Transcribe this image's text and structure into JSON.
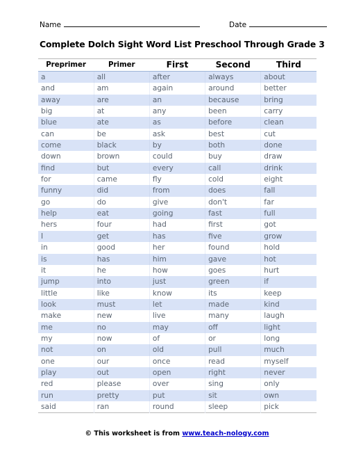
{
  "worksheet": {
    "name_label": "Name",
    "date_label": "Date",
    "title": "Complete Dolch Sight Word List Preschool Through Grade 3"
  },
  "footer": {
    "copyright_text": "© This worksheet is from",
    "link_text": "www.teach-nology.com",
    "link_color": "#0000cc"
  },
  "table": {
    "columns": [
      {
        "label": "Preprimer",
        "size": "small"
      },
      {
        "label": "Primer",
        "size": "small"
      },
      {
        "label": "First",
        "size": "big"
      },
      {
        "label": "Second",
        "size": "big"
      },
      {
        "label": "Third",
        "size": "big"
      }
    ],
    "row_band_color": "#d9e3f7",
    "text_color": "#5b6572",
    "rows": [
      [
        "a",
        "all",
        "after",
        "always",
        "about"
      ],
      [
        "and",
        "am",
        "again",
        "around",
        "better"
      ],
      [
        "away",
        "are",
        "an",
        "because",
        "bring"
      ],
      [
        "big",
        "at",
        "any",
        "been",
        "carry"
      ],
      [
        "blue",
        "ate",
        "as",
        "before",
        "clean"
      ],
      [
        "can",
        "be",
        "ask",
        "best",
        "cut"
      ],
      [
        "come",
        "black",
        "by",
        "both",
        "done"
      ],
      [
        "down",
        "brown",
        "could",
        "buy",
        "draw"
      ],
      [
        "find",
        "but",
        "every",
        "call",
        "drink"
      ],
      [
        "for",
        "came",
        "fly",
        "cold",
        "eight"
      ],
      [
        "funny",
        "did",
        "from",
        "does",
        "fall"
      ],
      [
        "go",
        "do",
        "give",
        "don't",
        "far"
      ],
      [
        "help",
        "eat",
        "going",
        "fast",
        "full"
      ],
      [
        "hers",
        "four",
        "had",
        "first",
        "got"
      ],
      [
        "I",
        "get",
        "has",
        "five",
        "grow"
      ],
      [
        "in",
        "good",
        "her",
        "found",
        "hold"
      ],
      [
        "is",
        "has",
        "him",
        "gave",
        "hot"
      ],
      [
        "it",
        "he",
        "how",
        "goes",
        "hurt"
      ],
      [
        "jump",
        "into",
        "just",
        "green",
        "if"
      ],
      [
        "little",
        "like",
        "know",
        "its",
        "keep"
      ],
      [
        "look",
        "must",
        "let",
        "made",
        "kind"
      ],
      [
        "make",
        "new",
        "live",
        "many",
        "laugh"
      ],
      [
        "me",
        "no",
        "may",
        "off",
        "light"
      ],
      [
        "my",
        "now",
        "of",
        "or",
        "long"
      ],
      [
        "not",
        "on",
        "old",
        "pull",
        "much"
      ],
      [
        "one",
        "our",
        "once",
        "read",
        "myself"
      ],
      [
        "play",
        "out",
        "open",
        "right",
        "never"
      ],
      [
        "red",
        "please",
        "over",
        "sing",
        "only"
      ],
      [
        "run",
        "pretty",
        "put",
        "sit",
        "own"
      ],
      [
        "said",
        "ran",
        "round",
        "sleep",
        "pick"
      ]
    ]
  }
}
